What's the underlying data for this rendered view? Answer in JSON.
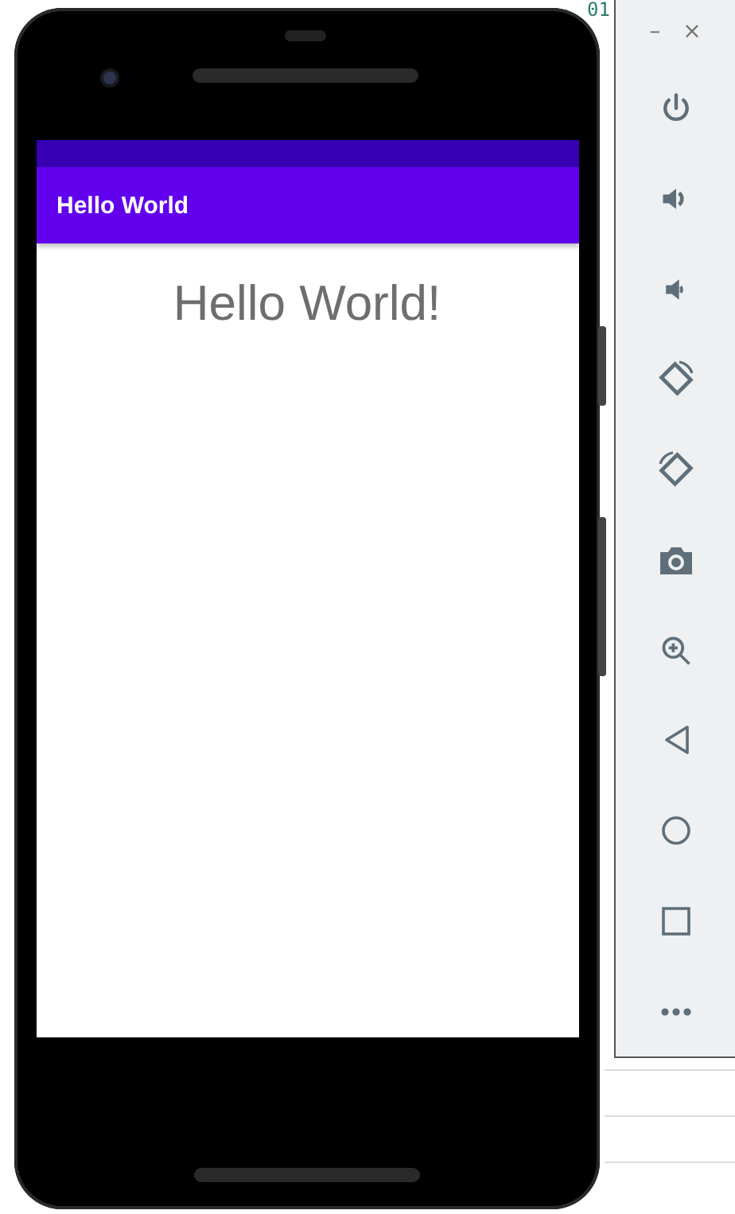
{
  "background_text": "01",
  "emulator_panel": {
    "window_controls": [
      {
        "label": "–"
      },
      {
        "label": "×"
      }
    ]
  },
  "app_bar": {
    "title": "Hello World"
  },
  "content": {
    "text": "Hello World!"
  }
}
